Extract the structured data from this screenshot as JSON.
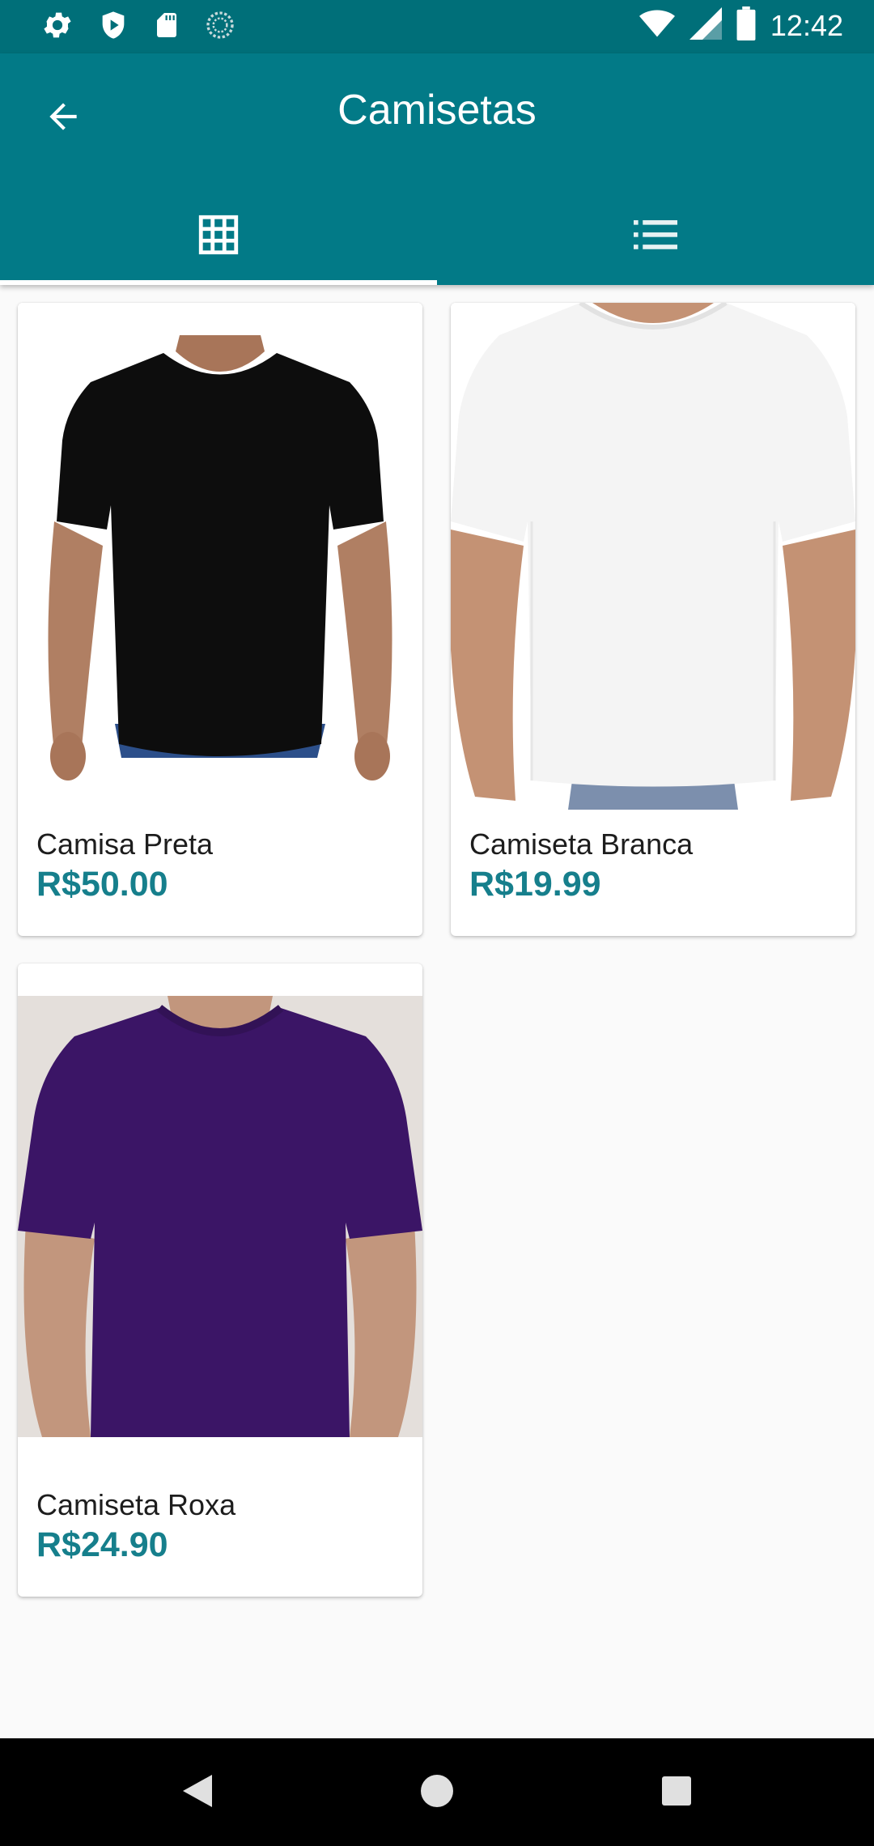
{
  "status_bar": {
    "time": "12:42",
    "left_icons": [
      "gear-icon",
      "shield-play-icon",
      "sd-card-icon",
      "sync-icon"
    ],
    "right_icons": [
      "wifi-icon",
      "signal-icon",
      "battery-icon"
    ]
  },
  "app_bar": {
    "title": "Camisetas",
    "back_icon": "arrow-back-icon",
    "background": "#027a87"
  },
  "tabs": [
    {
      "icon": "grid-icon",
      "selected": true
    },
    {
      "icon": "list-icon",
      "selected": false
    }
  ],
  "products": [
    {
      "name": "Camisa Preta",
      "price": "R$50.00",
      "shirt_color": "#0d0d0d"
    },
    {
      "name": "Camiseta Branca",
      "price": "R$19.99",
      "shirt_color": "#f4f4f4"
    },
    {
      "name": "Camiseta Roxa",
      "price": "R$24.90",
      "shirt_color": "#3b1566"
    }
  ],
  "colors": {
    "status_bar": "#006f79",
    "accent": "#167f8c",
    "background": "#fafafa"
  },
  "nav_bar": {
    "icons": [
      "nav-back-icon",
      "nav-home-icon",
      "nav-recents-icon"
    ]
  }
}
